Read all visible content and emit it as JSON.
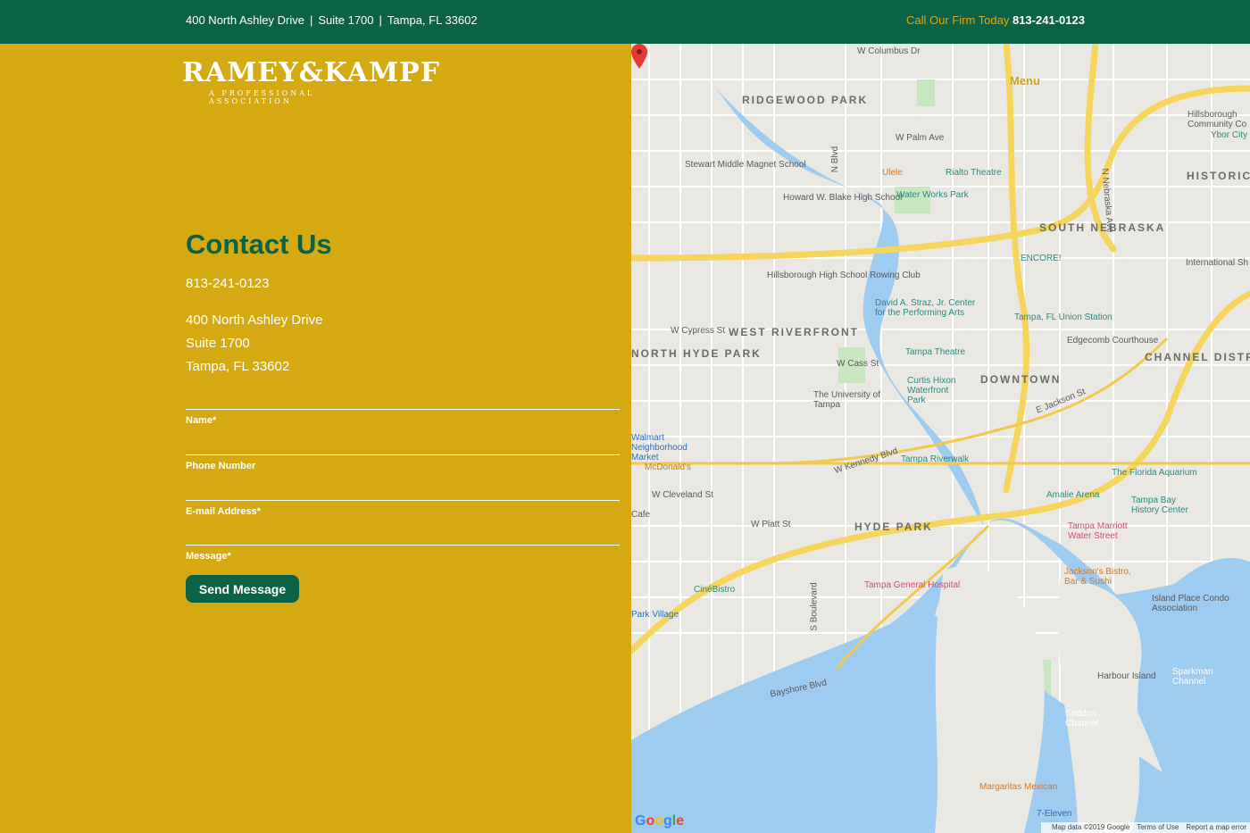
{
  "topbar": {
    "address_line1": "400 North Ashley Drive",
    "address_line2": "Suite 1700",
    "address_line3": "Tampa, FL 33602",
    "separator": "|",
    "call_label": "Call Our Firm Today",
    "call_number": "813-241-0123"
  },
  "logo": {
    "name": "RAMEY&KAMPF",
    "tagline": "A PROFESSIONAL ASSOCIATION"
  },
  "contact": {
    "title": "Contact Us",
    "phone": "813-241-0123",
    "street": "400 North Ashley Drive",
    "suite": "Suite 1700",
    "city": "Tampa, FL 33602"
  },
  "form": {
    "name_label": "Name*",
    "phone_label": "Phone Number",
    "email_label": "E-mail Address*",
    "message_label": "Message*",
    "submit_label": "Send Message"
  },
  "map": {
    "menu_label": "Menu",
    "districts": [
      "RIDGEWOOD PARK",
      "WEST RIVERFRONT",
      "NORTH HYDE PARK",
      "DOWNTOWN",
      "HYDE PARK",
      "SOUTH NEBRASKA",
      "CHANNEL DISTRICT",
      "HISTORIC"
    ],
    "pois": {
      "stewart": "Stewart Middle Magnet School",
      "howard": "Howard W. Blake High School",
      "waterworks": "Water Works Park",
      "rialto": "Rialto Theatre",
      "uele": "Ulele",
      "encore": "ENCORE!",
      "hillsborough": "Hillsborough High School Rowing Club",
      "straz": "David A. Straz, Jr. Center for the Performing Arts",
      "union": "Tampa, FL Union Station",
      "edgecomb": "Edgecomb Courthouse",
      "theatre": "Tampa Theatre",
      "curtis": "Curtis Hixon Waterfront Park",
      "ut": "The University of Tampa",
      "walmart": "Walmart Neighborhood Market",
      "mcdonalds": "McDonald's",
      "riverwalk": "Tampa Riverwalk",
      "aquarium": "The Florida Aquarium",
      "amalie": "Amalie Arena",
      "history": "Tampa Bay History Center",
      "marriott": "Tampa Marriott Water Street",
      "cinebistro": "CinéBistro",
      "tgh": "Tampa General Hospital",
      "jacksons": "Jackson's Bistro, Bar & Sushi",
      "island": "Island Place Condo Association",
      "parkvillage": "Park Village",
      "harbour": "Harbour Island",
      "seddon": "Seddon Channel",
      "sparkman": "Sparkman Channel",
      "margaritas": "Margaritas Mexican",
      "seveneleven": "7-Eleven",
      "hillsboroughcc": "Hillsborough Community Co",
      "ybor": "Ybor City",
      "cafe": "Cafe",
      "international": "International Sh"
    },
    "streets": {
      "kennedy": "W Kennedy Blvd",
      "jackson": "E Jackson St",
      "bayshore": "Bayshore Blvd",
      "cleveland": "W Cleveland St",
      "cass": "W Cass St",
      "cypress": "W Cypress St",
      "palm": "W Palm Ave",
      "columbus": "W Columbus Dr",
      "nebraska": "N Nebraska Ave",
      "nblvd": "N Blvd",
      "boulevard": "S Boulevard",
      "platt": "W Platt St"
    },
    "footer_data": "Map data ©2019 Google",
    "footer_terms": "Terms of Use",
    "footer_report": "Report a map error",
    "google": [
      "G",
      "o",
      "o",
      "g",
      "l",
      "e"
    ]
  }
}
